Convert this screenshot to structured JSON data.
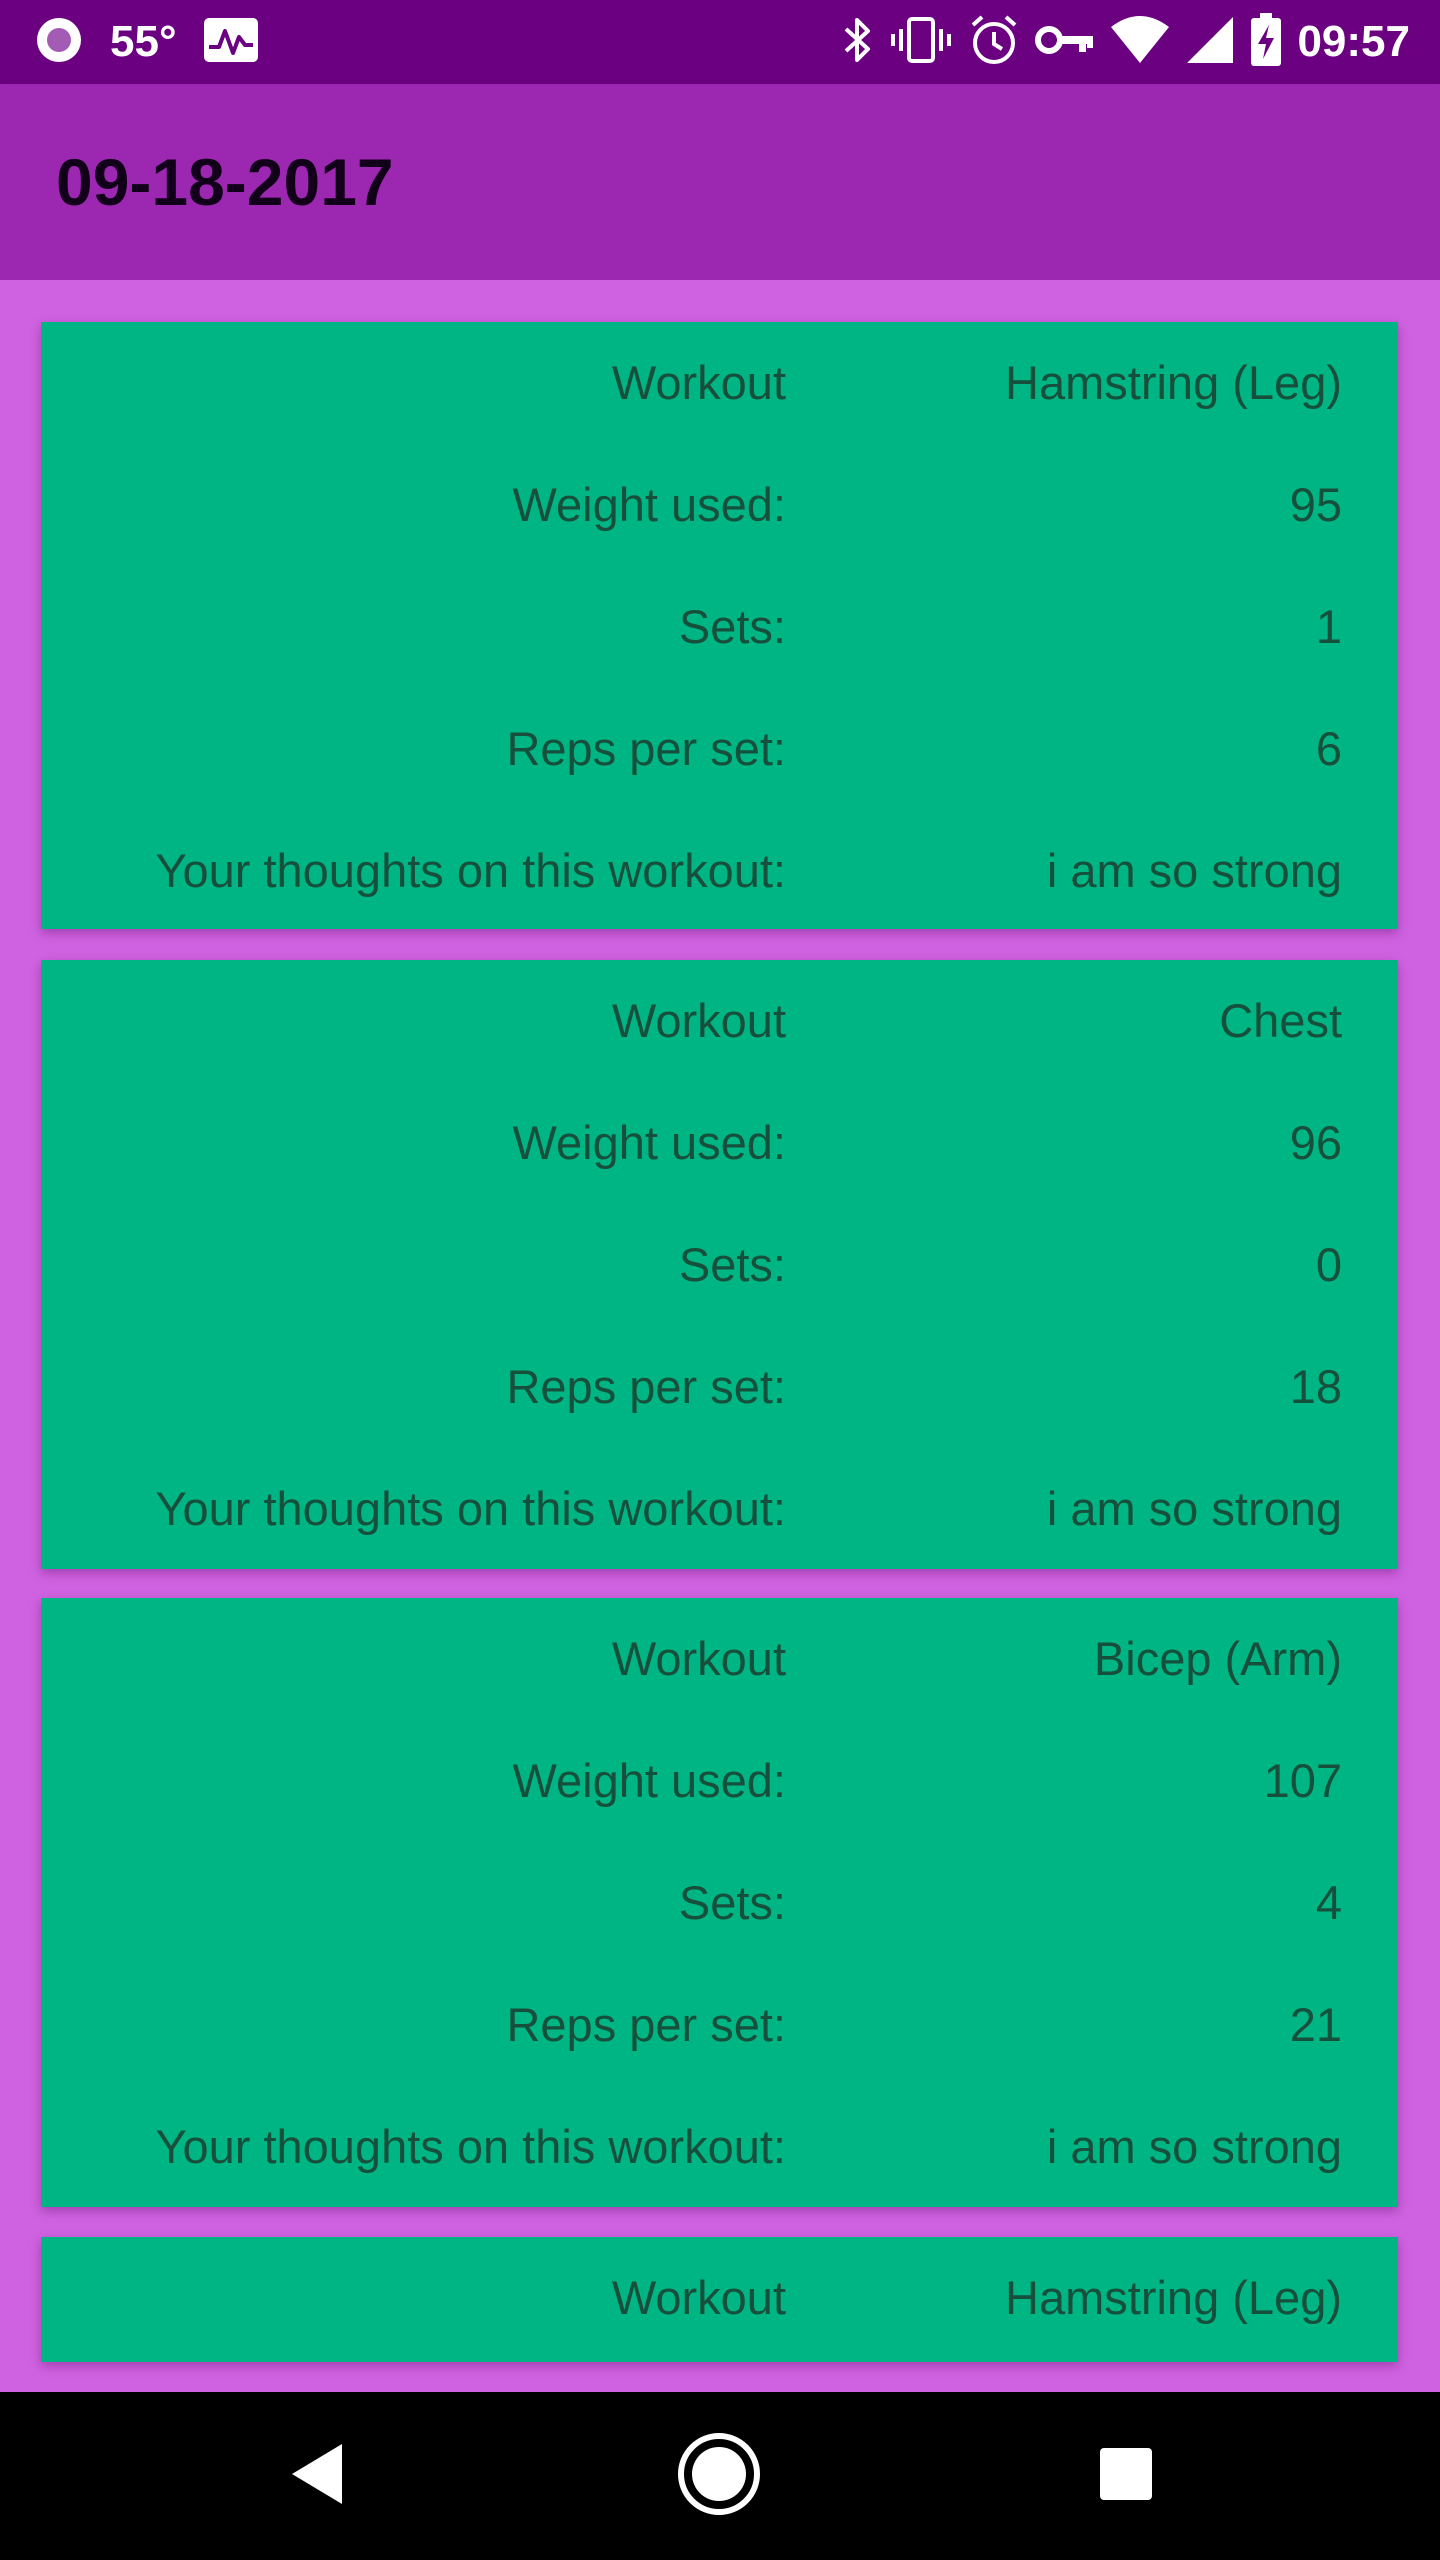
{
  "status_bar": {
    "temperature": "55°",
    "time": "09:57",
    "icons": [
      "record-icon",
      "activity-icon",
      "bluetooth-icon",
      "vibrate-icon",
      "alarm-icon",
      "vpn-key-icon",
      "wifi-icon",
      "cellular-signal-icon",
      "battery-charging-icon"
    ]
  },
  "app_bar": {
    "title": "09-18-2017"
  },
  "cards": [
    {
      "workout_label": "Workout",
      "workout_value": "Hamstring (Leg)",
      "weight_label": "Weight used:",
      "weight_value": "95",
      "sets_label": "Sets:",
      "sets_value": "1",
      "reps_label": "Reps per set:",
      "reps_value": "6",
      "thoughts_label": "Your thoughts on this workout:",
      "thoughts_value": "i am so strong"
    },
    {
      "workout_label": "Workout",
      "workout_value": "Chest",
      "weight_label": "Weight used:",
      "weight_value": "96",
      "sets_label": "Sets:",
      "sets_value": "0",
      "reps_label": "Reps per set:",
      "reps_value": "18",
      "thoughts_label": "Your thoughts on this workout:",
      "thoughts_value": "i am so strong"
    },
    {
      "workout_label": "Workout",
      "workout_value": "Bicep (Arm)",
      "weight_label": "Weight used:",
      "weight_value": "107",
      "sets_label": "Sets:",
      "sets_value": "4",
      "reps_label": "Reps per set:",
      "reps_value": "21",
      "thoughts_label": "Your thoughts on this workout:",
      "thoughts_value": "i am so strong"
    },
    {
      "workout_label": "Workout",
      "workout_value": "Hamstring (Leg)"
    }
  ],
  "nav_bar": {
    "icons": [
      "back-icon",
      "home-icon",
      "recents-icon"
    ]
  },
  "colors": {
    "status_bar": "#6b0080",
    "app_bar": "#9c27b0",
    "background": "#cf62e0",
    "card": "#00b584",
    "card_text": "#16503c"
  }
}
